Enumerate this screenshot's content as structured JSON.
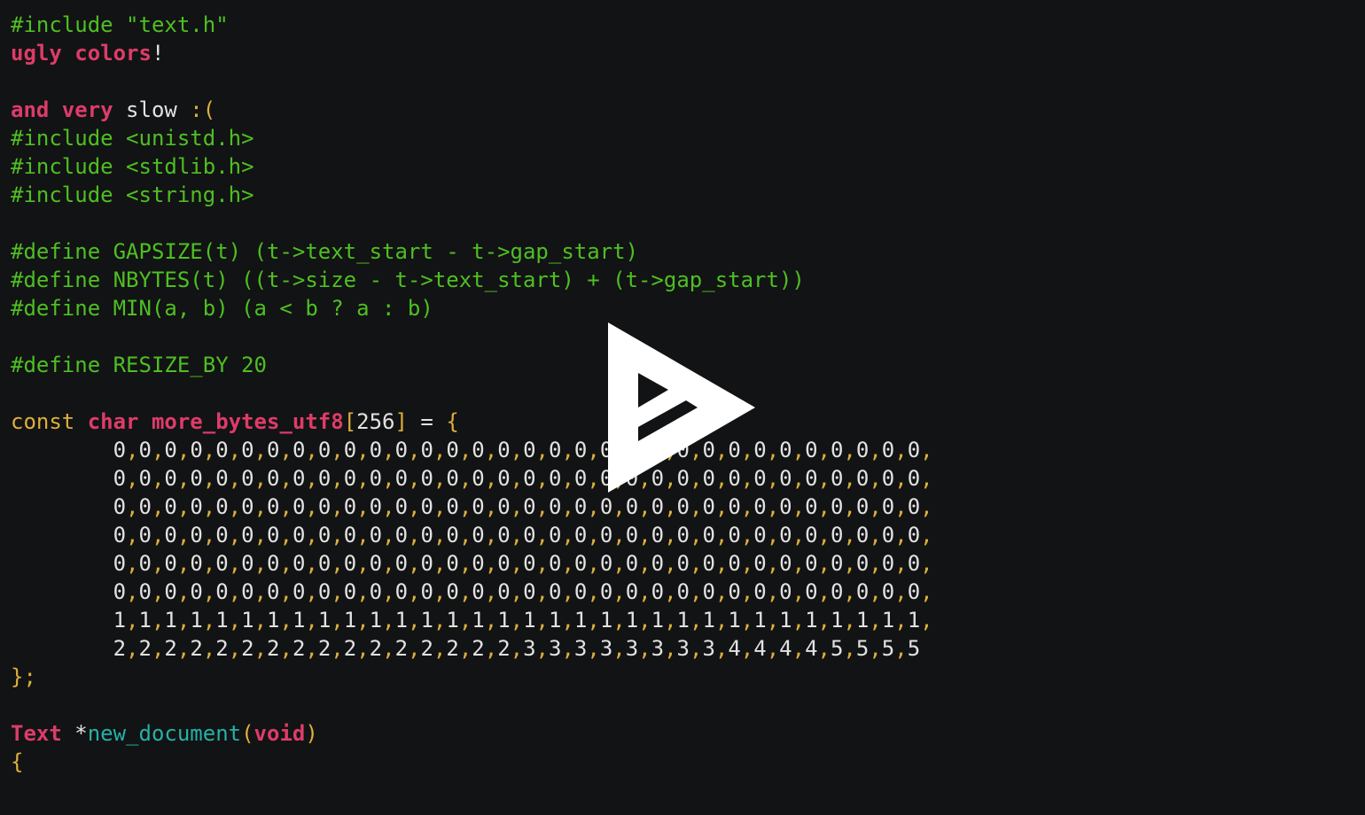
{
  "colors": {
    "background": "#121314",
    "text": "#e2e2e2",
    "preprocessor": "#4ebf22",
    "keyword": "#dd3c69",
    "punctuation": "#ddaf3c",
    "function_name": "#26b0a7",
    "play_icon": "#ffffff"
  },
  "play_button": {
    "icon": "asciinema-play-icon"
  },
  "code_lines": [
    [
      {
        "t": "#include \"text.h\"",
        "c": "green"
      }
    ],
    [
      {
        "t": "ugly colors",
        "c": "red"
      },
      {
        "t": "!",
        "c": "text"
      }
    ],
    [],
    [
      {
        "t": "and very",
        "c": "red"
      },
      {
        "t": " slow ",
        "c": "text"
      },
      {
        "t": ":(",
        "c": "yellow"
      }
    ],
    [
      {
        "t": "#include <unistd.h>",
        "c": "green"
      }
    ],
    [
      {
        "t": "#include <stdlib.h>",
        "c": "green"
      }
    ],
    [
      {
        "t": "#include <string.h>",
        "c": "green"
      }
    ],
    [],
    [
      {
        "t": "#define GAPSIZE(t) (t->text_start - t->gap_start)",
        "c": "green"
      }
    ],
    [
      {
        "t": "#define NBYTES(t) ((t->size - t->text_start) + (t->gap_start))",
        "c": "green"
      }
    ],
    [
      {
        "t": "#define MIN(a, b) (a < b ? a : b)",
        "c": "green"
      }
    ],
    [],
    [
      {
        "t": "#define RESIZE_BY 20",
        "c": "green"
      }
    ],
    [],
    [
      {
        "t": "const ",
        "c": "yellow"
      },
      {
        "t": "char more_bytes_utf8",
        "c": "red"
      },
      {
        "t": "[",
        "c": "yellow"
      },
      {
        "t": "256",
        "c": "text"
      },
      {
        "t": "]",
        "c": "yellow"
      },
      {
        "t": " = ",
        "c": "text"
      },
      {
        "t": "{",
        "c": "yellow"
      }
    ],
    [
      {
        "t": "        ",
        "c": "text"
      },
      {
        "t": "0,0,0,0,0,0,0,0,0,0,0,0,0,0,0,0,0,0,0,0,0,0,0,0,0,0,0,0,0,0,0,0,",
        "c": "nums"
      }
    ],
    [
      {
        "t": "        ",
        "c": "text"
      },
      {
        "t": "0,0,0,0,0,0,0,0,0,0,0,0,0,0,0,0,0,0,0,0,0,0,0,0,0,0,0,0,0,0,0,0,",
        "c": "nums"
      }
    ],
    [
      {
        "t": "        ",
        "c": "text"
      },
      {
        "t": "0,0,0,0,0,0,0,0,0,0,0,0,0,0,0,0,0,0,0,0,0,0,0,0,0,0,0,0,0,0,0,0,",
        "c": "nums"
      }
    ],
    [
      {
        "t": "        ",
        "c": "text"
      },
      {
        "t": "0,0,0,0,0,0,0,0,0,0,0,0,0,0,0,0,0,0,0,0,0,0,0,0,0,0,0,0,0,0,0,0,",
        "c": "nums"
      }
    ],
    [
      {
        "t": "        ",
        "c": "text"
      },
      {
        "t": "0,0,0,0,0,0,0,0,0,0,0,0,0,0,0,0,0,0,0,0,0,0,0,0,0,0,0,0,0,0,0,0,",
        "c": "nums"
      }
    ],
    [
      {
        "t": "        ",
        "c": "text"
      },
      {
        "t": "0,0,0,0,0,0,0,0,0,0,0,0,0,0,0,0,0,0,0,0,0,0,0,0,0,0,0,0,0,0,0,0,",
        "c": "nums"
      }
    ],
    [
      {
        "t": "        ",
        "c": "text"
      },
      {
        "t": "1,1,1,1,1,1,1,1,1,1,1,1,1,1,1,1,1,1,1,1,1,1,1,1,1,1,1,1,1,1,1,1,",
        "c": "nums"
      }
    ],
    [
      {
        "t": "        ",
        "c": "text"
      },
      {
        "t": "2,2,2,2,2,2,2,2,2,2,2,2,2,2,2,2,3,3,3,3,3,3,3,3,4,4,4,4,5,5,5,5",
        "c": "nums"
      }
    ],
    [
      {
        "t": "};",
        "c": "yellow"
      }
    ],
    [],
    [
      {
        "t": "Text",
        "c": "red"
      },
      {
        "t": " *",
        "c": "text"
      },
      {
        "t": "new_document",
        "c": "teal"
      },
      {
        "t": "(",
        "c": "yellow"
      },
      {
        "t": "void",
        "c": "red"
      },
      {
        "t": ")",
        "c": "yellow"
      }
    ],
    [
      {
        "t": "{",
        "c": "yellow"
      }
    ]
  ]
}
